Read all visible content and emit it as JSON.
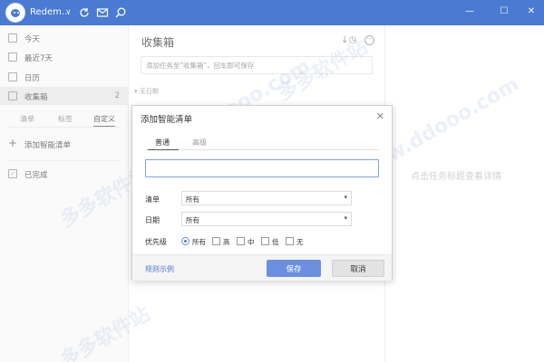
{
  "titlebar": {
    "username": "Redem...",
    "caret": "v",
    "icons": [
      "sync-icon",
      "mail-icon",
      "search-icon"
    ],
    "window_controls": {
      "minimize": "—",
      "maximize": "☐",
      "close": "✕"
    },
    "accent": "#4a7ad1"
  },
  "sidebar": {
    "items": [
      {
        "label": "今天",
        "icon": "calendar-day-icon"
      },
      {
        "label": "最近7天",
        "icon": "calendar-week-icon"
      },
      {
        "label": "日历",
        "icon": "calendar-icon"
      },
      {
        "label": "收集箱",
        "icon": "inbox-icon",
        "count": "2",
        "active": true
      }
    ],
    "tabs": [
      {
        "label": "清单"
      },
      {
        "label": "标签"
      },
      {
        "label": "自定义",
        "active": true
      }
    ],
    "add_smart_list": "添加智能清单",
    "completed": "已完成"
  },
  "middle": {
    "title": "收集箱",
    "add_placeholder": "添加任务至\"收集箱\"，回车即可保存",
    "group_header": "▾ 无日期"
  },
  "right": {
    "hint": "点击任务标题查看详情"
  },
  "dialog": {
    "title": "添加智能清单",
    "close": "✕",
    "tabs": [
      {
        "label": "普通",
        "active": true
      },
      {
        "label": "高级"
      }
    ],
    "name_value": "",
    "list_label": "清单",
    "list_value": "所有",
    "date_label": "日期",
    "date_value": "所有",
    "priority_label": "优先级",
    "priority_all": "所有",
    "priority_options": [
      "高",
      "中",
      "低",
      "无"
    ],
    "example_link": "规则示例",
    "save_label": "保存",
    "cancel_label": "取消"
  },
  "watermark": {
    "text1": "www.ddooo.com",
    "text2": "多多软件站"
  }
}
